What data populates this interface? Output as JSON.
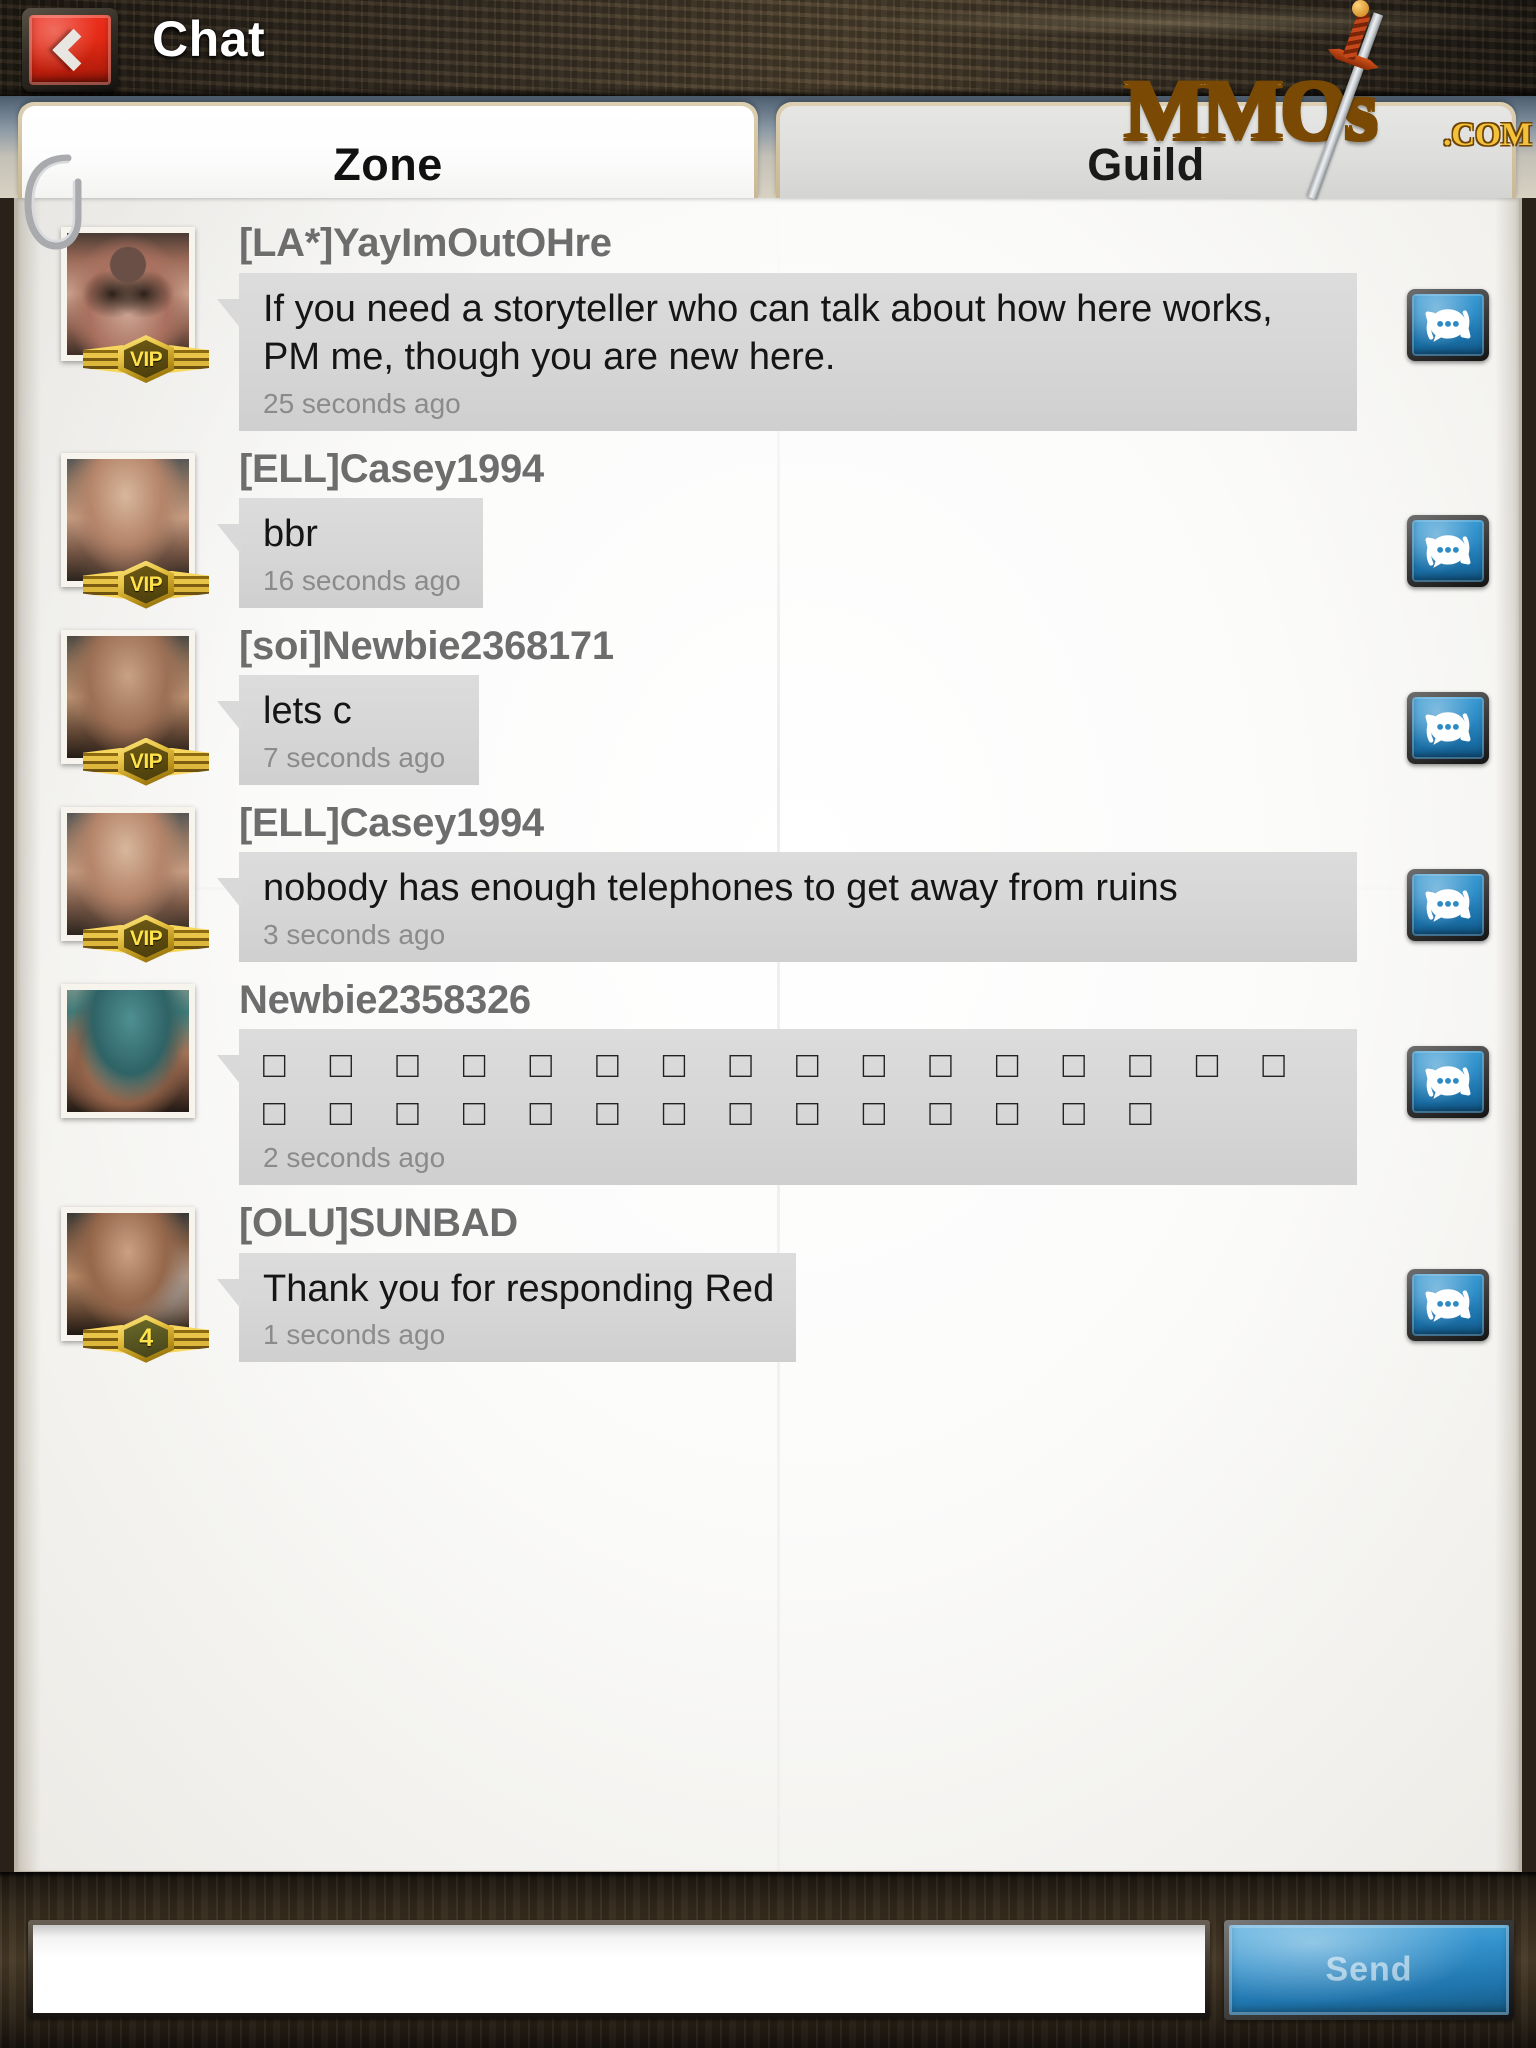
{
  "header": {
    "title": "Chat",
    "back_icon": "back-chevron-icon"
  },
  "tabs": [
    {
      "label": "Zone",
      "active": true,
      "name": "tab-zone"
    },
    {
      "label": "Guild",
      "active": false,
      "name": "tab-guild"
    }
  ],
  "chat": {
    "reply_icon": "reply-speech-bubble-icon",
    "messages": [
      {
        "username": "[LA*]YayImOutOHre",
        "text": "If you need a storyteller who can talk about how here works, PM me, though you are new here.",
        "time": "25 seconds ago",
        "badge": "VIP",
        "badge_type": "vip",
        "avatar": "avatar-tattooed-man",
        "wide": true
      },
      {
        "username": "[ELL]Casey1994",
        "text": "bbr",
        "time": "16 seconds ago",
        "badge": "VIP",
        "badge_type": "vip",
        "avatar": "avatar-bald-soldier",
        "wide": false
      },
      {
        "username": "[soi]Newbie2368171",
        "text": "lets c",
        "time": "7 seconds ago",
        "badge": "VIP",
        "badge_type": "vip",
        "avatar": "avatar-bearded-man",
        "wide": false
      },
      {
        "username": "[ELL]Casey1994",
        "text": "nobody has enough telephones to get away from ruins",
        "time": "3 seconds ago",
        "badge": "VIP",
        "badge_type": "vip",
        "avatar": "avatar-bald-soldier",
        "wide": true
      },
      {
        "username": "Newbie2358326",
        "text": "□ □ □ □  □ □  □ □ □  □ □ □ □ □ □  □ □ □ □  □ □  □ □  □ □ □ □ □  □ □",
        "time": "2 seconds ago",
        "badge": "",
        "badge_type": "none",
        "avatar": "avatar-beret-scout",
        "wide": true,
        "unrenderable": true
      },
      {
        "username": "[OLU]SUNBAD",
        "text": "Thank you for responding Red",
        "time": "1 seconds ago",
        "badge": "4",
        "badge_type": "level",
        "avatar": "avatar-armored-man",
        "wide": false
      }
    ]
  },
  "composer": {
    "input_value": "",
    "input_placeholder": "",
    "send_label": "Send"
  },
  "watermark": {
    "brand": "MMOs",
    "tld": ".COM"
  },
  "colors": {
    "accent_red": "#e22a14",
    "accent_blue": "#2d8cc6",
    "badge_gold": "#e9c545",
    "username_gray": "#6d6d6d",
    "bubble_gray": "#d6d6d6"
  }
}
